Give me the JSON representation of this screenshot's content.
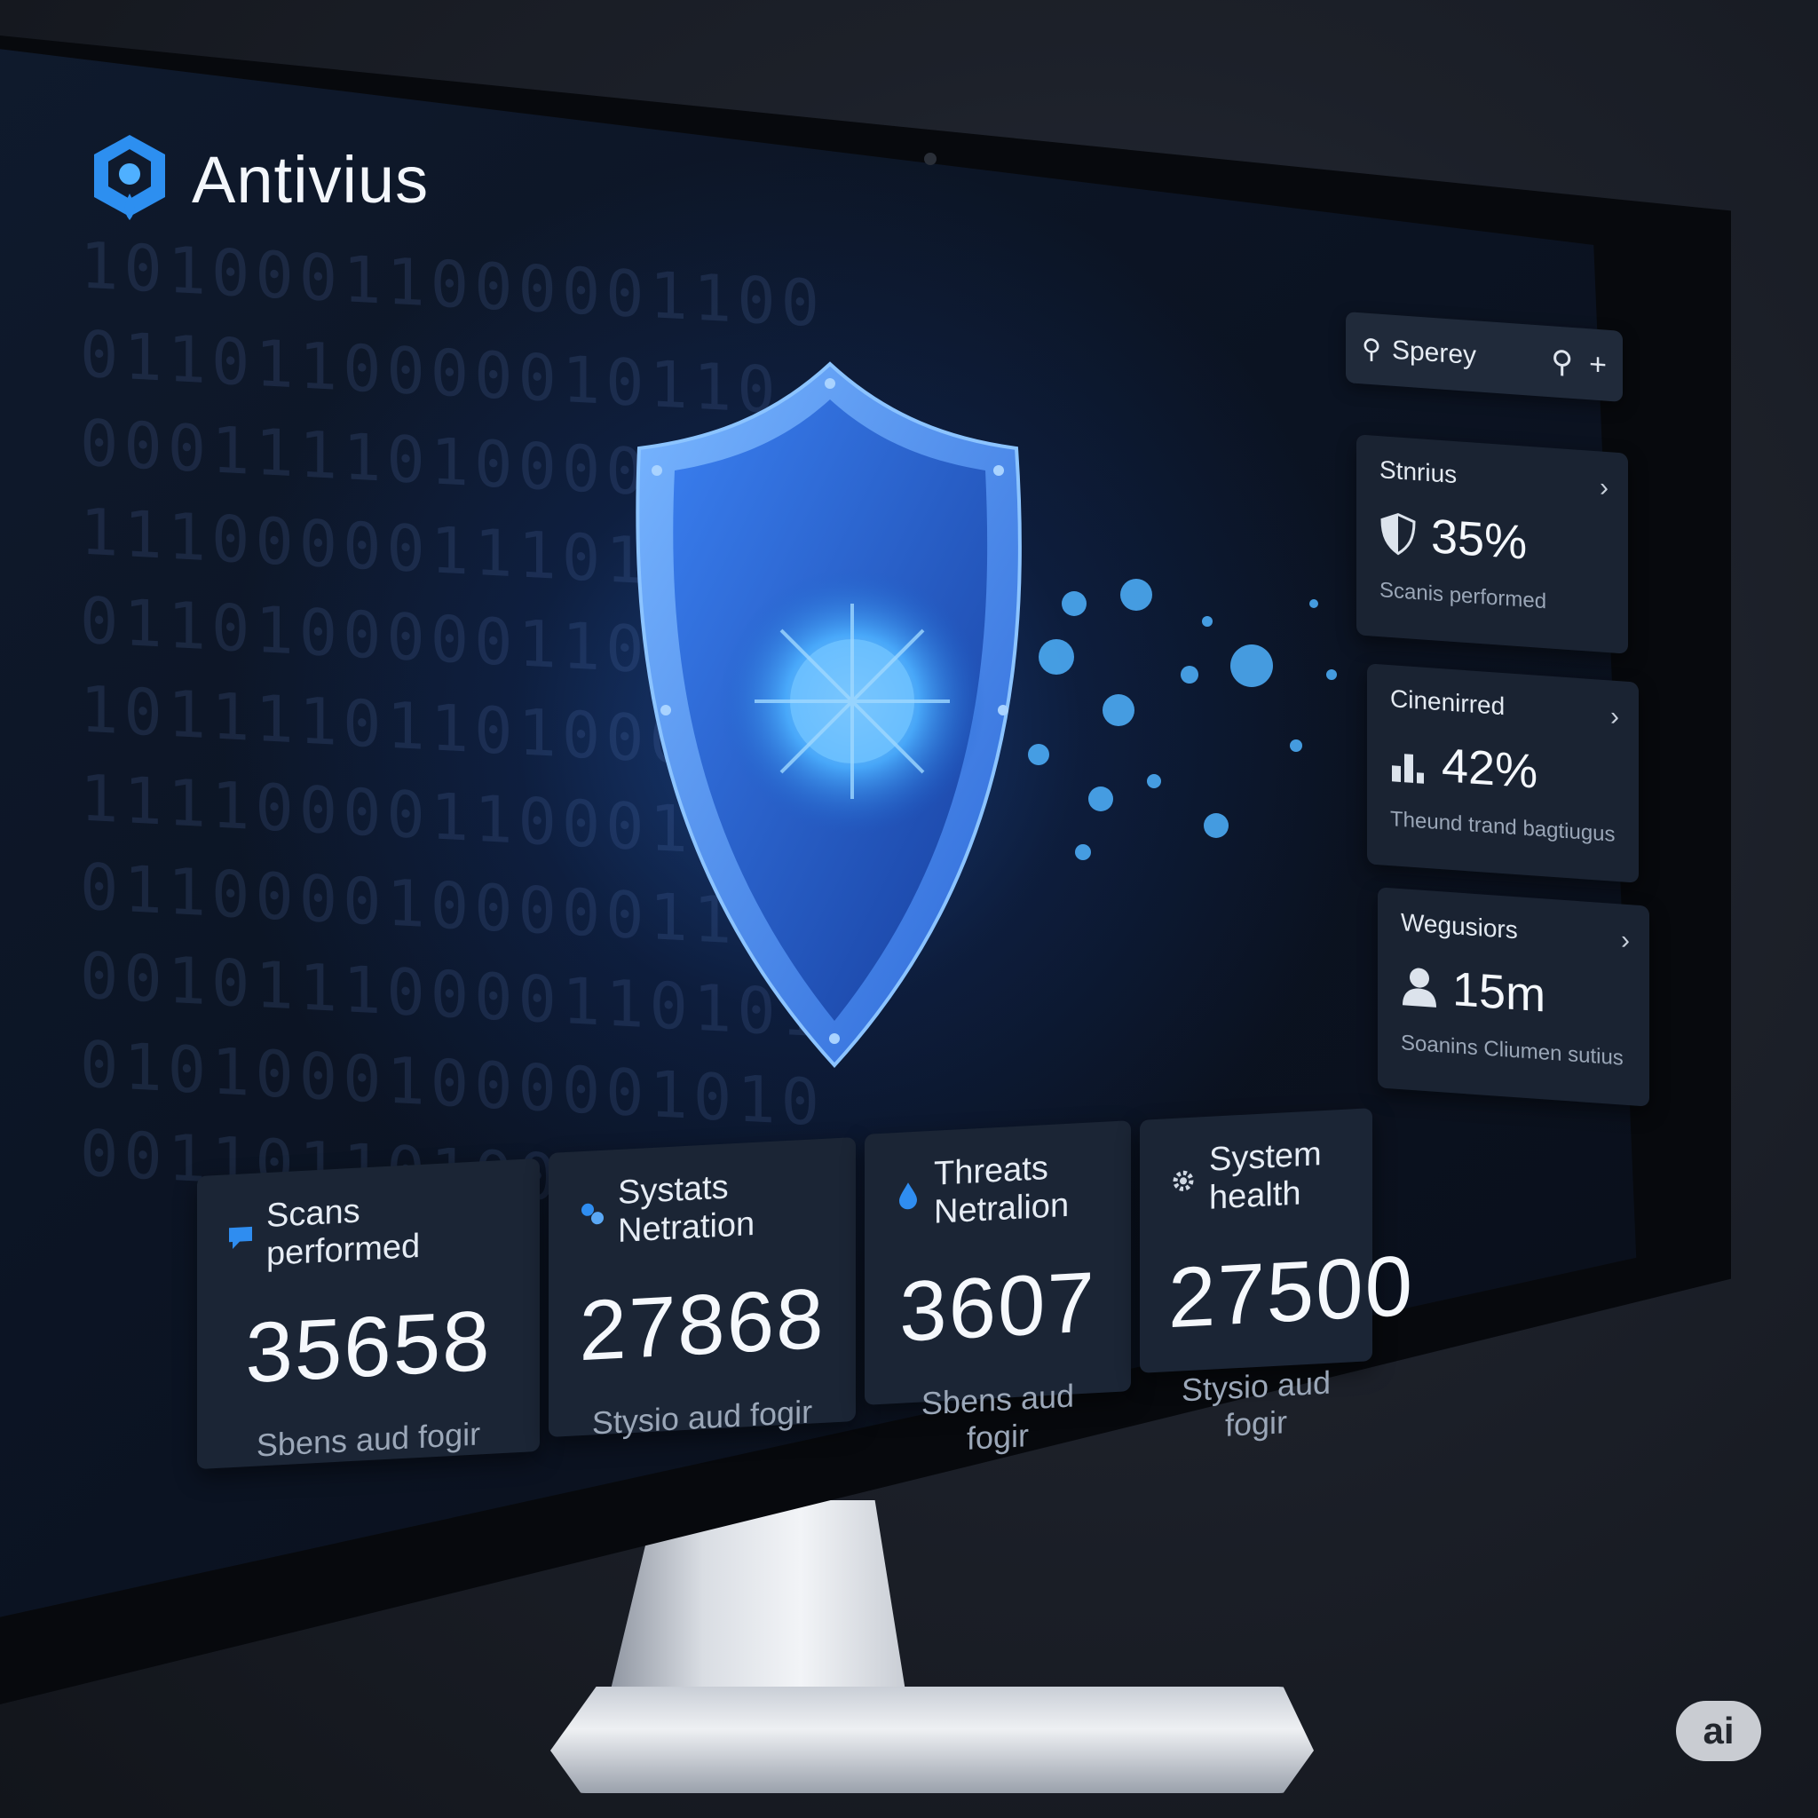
{
  "app": {
    "name": "Antivius"
  },
  "search": {
    "value": "Sperey",
    "search_icon": "search-icon",
    "add_icon": "plus-icon"
  },
  "side_cards": [
    {
      "title": "Stnrius",
      "value": "35%",
      "subtitle": "Scanis performed",
      "icon": "shield-icon"
    },
    {
      "title": "Cinenirred",
      "value": "42%",
      "subtitle": "Theund trand bagtiugus",
      "icon": "bar-chart-icon"
    },
    {
      "title": "Wegusiors",
      "value": "15m",
      "subtitle": "Soanins Cliumen sutius",
      "icon": "user-icon"
    }
  ],
  "stats": [
    {
      "label": "Scans performed",
      "value": "35658",
      "subtitle": "Sbens aud fogir",
      "icon": "chat-bubble-icon"
    },
    {
      "label": "Systats Netration",
      "value": "27868",
      "subtitle": "Stysio aud fogir",
      "icon": "cog-cluster-icon"
    },
    {
      "label": "Threats Netralion",
      "value": "3607",
      "subtitle": "Sbens aud fogir",
      "icon": "drop-icon"
    },
    {
      "label": "System health",
      "value": "27500",
      "subtitle": "Stysio aud fogir",
      "icon": "gear-icon"
    }
  ],
  "badge": {
    "label": "ai"
  },
  "colors": {
    "accent": "#2f8df0",
    "card_bg": "#1b2535",
    "screen_bg": "#0b1322"
  }
}
